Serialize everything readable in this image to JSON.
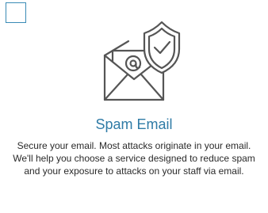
{
  "card": {
    "title": "Spam Email",
    "description": "Secure your email. Most attacks originate in your email. We'll help you choose a service designed to reduce spam and your exposure to attacks on your staff via email.",
    "checked": false,
    "illustration_icon": "envelope-with-shield-checkmark-icon",
    "accent_color": "#2f7ba6",
    "checkbox_border_color": "#3a8bb5",
    "icon_stroke_color": "#555555"
  }
}
